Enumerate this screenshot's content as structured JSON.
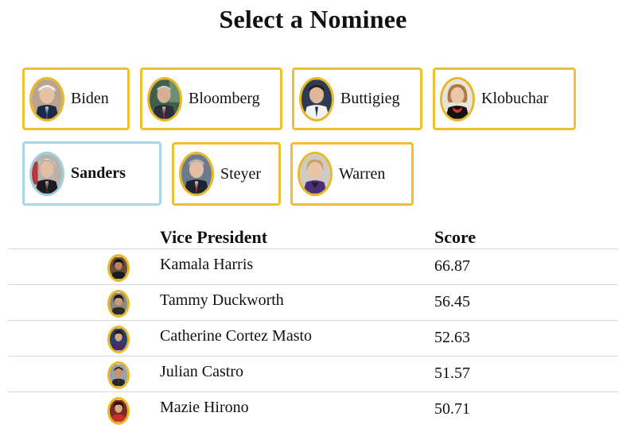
{
  "page": {
    "title": "Select a Nominee"
  },
  "nominees": [
    {
      "name": "Biden",
      "selected": false,
      "icon": "biden-photo"
    },
    {
      "name": "Bloomberg",
      "selected": false,
      "icon": "bloomberg-photo"
    },
    {
      "name": "Buttigieg",
      "selected": false,
      "icon": "buttigieg-photo"
    },
    {
      "name": "Klobuchar",
      "selected": false,
      "icon": "klobuchar-photo"
    },
    {
      "name": "Sanders",
      "selected": true,
      "icon": "sanders-photo"
    },
    {
      "name": "Steyer",
      "selected": false,
      "icon": "steyer-photo"
    },
    {
      "name": "Warren",
      "selected": false,
      "icon": "warren-photo"
    }
  ],
  "table": {
    "headers": {
      "vp": "Vice President",
      "score": "Score"
    },
    "rows": [
      {
        "name": "Kamala Harris",
        "score": "66.87"
      },
      {
        "name": "Tammy Duckworth",
        "score": "56.45"
      },
      {
        "name": "Catherine Cortez Masto",
        "score": "52.63"
      },
      {
        "name": "Julian Castro",
        "score": "51.57"
      },
      {
        "name": "Mazie Hirono",
        "score": "50.71"
      }
    ]
  },
  "colors": {
    "card_border": "#f0c030",
    "selected_border": "#a8d8e8",
    "row_divider": "#d8d8d8"
  }
}
